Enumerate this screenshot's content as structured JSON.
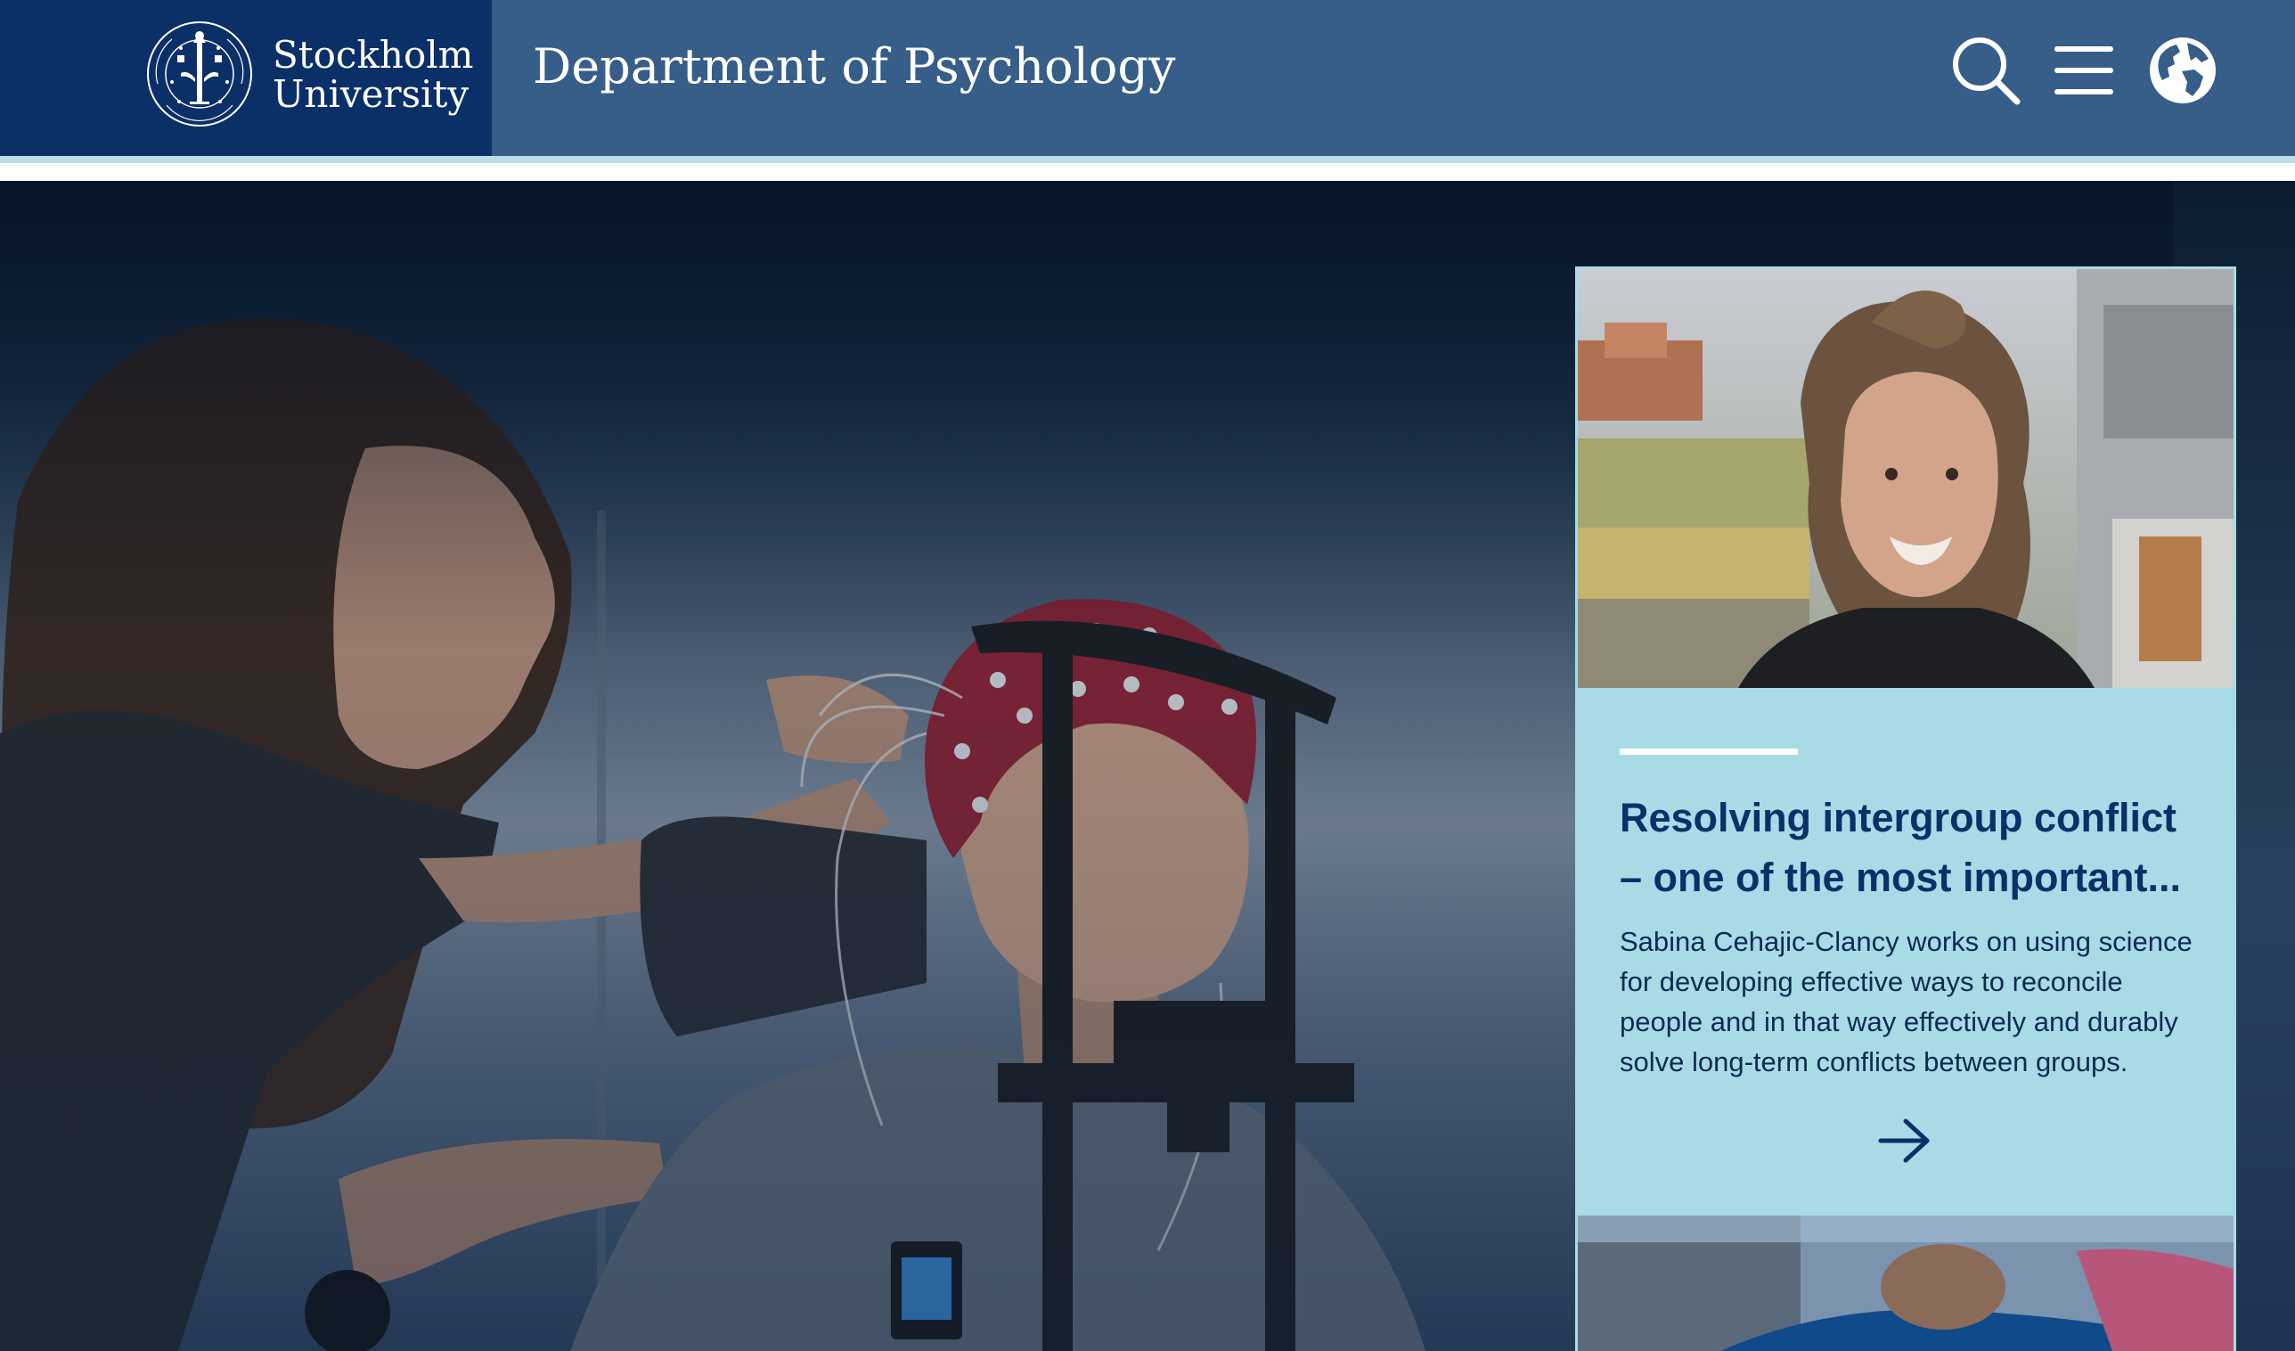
{
  "header": {
    "logo_line1": "Stockholm",
    "logo_line2": "University",
    "site_title": "Department of Psychology",
    "search_icon": "search-icon",
    "menu_icon": "hamburger-menu-icon",
    "language_icon": "globe-icon",
    "colors": {
      "bar": "#365e89",
      "logo_block": "#0b3068",
      "rule": "#b8dde8"
    }
  },
  "hero": {
    "image": "hero-photo-eeg-experiment"
  },
  "news_card": {
    "title": "Resolving intergroup conflict – one of the most important...",
    "summary": "Sabina Cehajic-Clancy works on using science for developing effective ways to reconcile people and in that way effectively and durably solve long-term conflicts between groups.",
    "arrow_icon": "arrow-right-icon",
    "colors": {
      "background": "#a9dbe6",
      "title": "#0b3068"
    }
  }
}
